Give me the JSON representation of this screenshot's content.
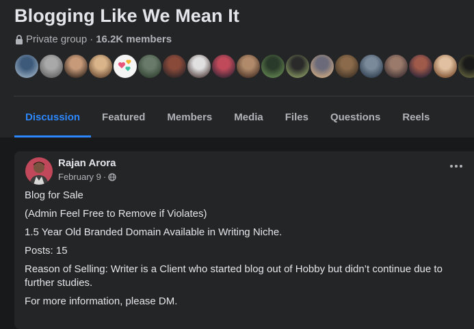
{
  "group": {
    "title": "Blogging Like We Mean It",
    "privacy": "Private group",
    "separator": "·",
    "members": "16.2K members"
  },
  "member_avatars": [
    {
      "icon": "member-avatar",
      "colors": [
        "#3d5a7a",
        "#8aa0b5"
      ]
    },
    {
      "icon": "member-avatar",
      "colors": [
        "#a9a9a9",
        "#6d6d6d"
      ]
    },
    {
      "icon": "member-avatar",
      "colors": [
        "#c79a7a",
        "#4d3a2e"
      ]
    },
    {
      "icon": "member-avatar",
      "colors": [
        "#d9b48a",
        "#7a5a40"
      ]
    },
    {
      "icon": "heart-emoji-avatar",
      "colors": [
        "#f5f5f5",
        "#e8557a"
      ]
    },
    {
      "icon": "member-avatar",
      "colors": [
        "#6a7a6a",
        "#3a4a3a"
      ]
    },
    {
      "icon": "member-avatar",
      "colors": [
        "#8a4a3a",
        "#3a2a2a"
      ]
    },
    {
      "icon": "member-avatar",
      "colors": [
        "#e0e0e0",
        "#6a5a5a"
      ]
    },
    {
      "icon": "member-avatar",
      "colors": [
        "#c04a5a",
        "#4a2a3a"
      ]
    },
    {
      "icon": "member-avatar",
      "colors": [
        "#b08a6a",
        "#5a4030"
      ]
    },
    {
      "icon": "member-avatar",
      "colors": [
        "#2a3a2a",
        "#5a7a4a"
      ]
    },
    {
      "icon": "member-avatar",
      "colors": [
        "#2a2a2a",
        "#7a8a5a"
      ]
    },
    {
      "icon": "member-avatar",
      "colors": [
        "#6a6a7a",
        "#c0a080"
      ]
    },
    {
      "icon": "member-avatar",
      "colors": [
        "#8a6a4a",
        "#4a3a2a"
      ]
    },
    {
      "icon": "member-avatar",
      "colors": [
        "#7a8a9a",
        "#3a4a5a"
      ]
    },
    {
      "icon": "member-avatar",
      "colors": [
        "#9a7a6a",
        "#4a3a3a"
      ]
    },
    {
      "icon": "member-avatar",
      "colors": [
        "#a05a4a",
        "#3a2a3a"
      ]
    },
    {
      "icon": "member-avatar",
      "colors": [
        "#e0c0a0",
        "#8a6040"
      ]
    },
    {
      "icon": "member-avatar",
      "colors": [
        "#1a1a1a",
        "#5a5a3a"
      ]
    }
  ],
  "tabs": [
    {
      "label": "Discussion",
      "active": true
    },
    {
      "label": "Featured",
      "active": false
    },
    {
      "label": "Members",
      "active": false
    },
    {
      "label": "Media",
      "active": false
    },
    {
      "label": "Files",
      "active": false
    },
    {
      "label": "Questions",
      "active": false
    },
    {
      "label": "Reels",
      "active": false
    }
  ],
  "post": {
    "author": "Rajan Arora",
    "date": "February 9",
    "date_separator": "·",
    "audience_icon": "globe-icon",
    "paragraphs": [
      "Blog for Sale",
      "(Admin Feel Free to Remove if Violates)",
      "1.5 Year Old Branded Domain Available in Writing Niche.",
      "Posts: 15",
      "Reason of Selling: Writer is a Client who started blog out of Hobby but didn’t continue due to further studies.",
      "For more information, please DM."
    ]
  },
  "colors": {
    "accent": "#2d88ff",
    "background": "#18191a",
    "surface": "#242526",
    "text_primary": "#e4e6eb",
    "text_secondary": "#b0b3b8"
  }
}
